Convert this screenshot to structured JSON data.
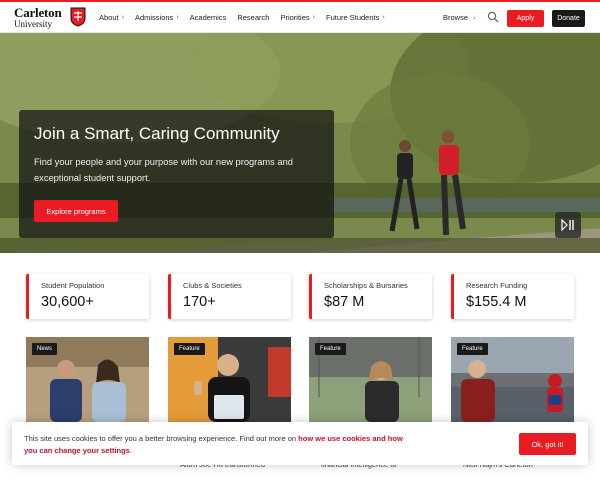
{
  "header": {
    "logo_name": "Carleton",
    "logo_sub": "University",
    "nav": [
      {
        "label": "About",
        "has_chevron": true
      },
      {
        "label": "Admissions",
        "has_chevron": true
      },
      {
        "label": "Academics",
        "has_chevron": false
      },
      {
        "label": "Research",
        "has_chevron": false
      },
      {
        "label": "Priorities",
        "has_chevron": true
      },
      {
        "label": "Future Students",
        "has_chevron": true
      }
    ],
    "browse_label": "Browse",
    "apply_label": "Apply",
    "donate_label": "Donate",
    "chevron": "›"
  },
  "hero": {
    "title": "Join a Smart, Caring Community",
    "text": "Find your people and your purpose with our new programs and exceptional student support.",
    "button_label": "Explore programs"
  },
  "stats": [
    {
      "label": "Student Population",
      "value": "30,600+"
    },
    {
      "label": "Clubs & Societies",
      "value": "170+"
    },
    {
      "label": "Scholarships & Bursaries",
      "value": "$87 M"
    },
    {
      "label": "Research Funding",
      "value": "$155.4 M"
    }
  ],
  "cards": [
    {
      "badge": "News",
      "text": ""
    },
    {
      "badge": "Feature",
      "text": "Alum Joe Hu transformed"
    },
    {
      "badge": "Feature",
      "text": "financial intelligence to"
    },
    {
      "badge": "Feature",
      "text": "Nick Najm's Carleton"
    }
  ],
  "cookie": {
    "text_before": "This site uses cookies to offer you a better browsing experience. Find out more on ",
    "link": "how we use cookies and how you can change your settings",
    "text_after": ".",
    "button_label": "Ok, got it!"
  },
  "colors": {
    "accent": "#e91c24",
    "dark": "#1a1a1a"
  }
}
